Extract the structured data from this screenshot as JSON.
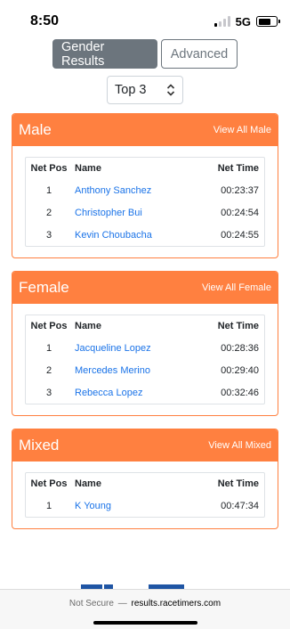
{
  "status_bar": {
    "time": "8:50",
    "network": "5G"
  },
  "tabs": [
    {
      "label": "Gender Results",
      "active": true
    },
    {
      "label": "Advanced",
      "active": false
    }
  ],
  "filter": {
    "selected": "Top 3"
  },
  "columns": {
    "pos": "Net Pos",
    "name": "Name",
    "time": "Net Time"
  },
  "sections": [
    {
      "title": "Male",
      "link": "View All Male",
      "rows": [
        {
          "pos": "1",
          "name": "Anthony Sanchez",
          "time": "00:23:37"
        },
        {
          "pos": "2",
          "name": "Christopher Bui",
          "time": "00:24:54"
        },
        {
          "pos": "3",
          "name": "Kevin Choubacha",
          "time": "00:24:55"
        }
      ]
    },
    {
      "title": "Female",
      "link": "View All Female",
      "rows": [
        {
          "pos": "1",
          "name": "Jacqueline Lopez",
          "time": "00:28:36"
        },
        {
          "pos": "2",
          "name": "Mercedes Merino",
          "time": "00:29:40"
        },
        {
          "pos": "3",
          "name": "Rebecca Lopez",
          "time": "00:32:46"
        }
      ]
    },
    {
      "title": "Mixed",
      "link": "View All Mixed",
      "rows": [
        {
          "pos": "1",
          "name": "K Young",
          "time": "00:47:34"
        }
      ]
    }
  ],
  "browser": {
    "security": "Not Secure",
    "separator": "—",
    "domain": "results.racetimers.com"
  },
  "colors": {
    "accent": "#ff8040",
    "link": "#1a73e8",
    "tab_active": "#6c757d",
    "logo": "#1f55a4"
  }
}
